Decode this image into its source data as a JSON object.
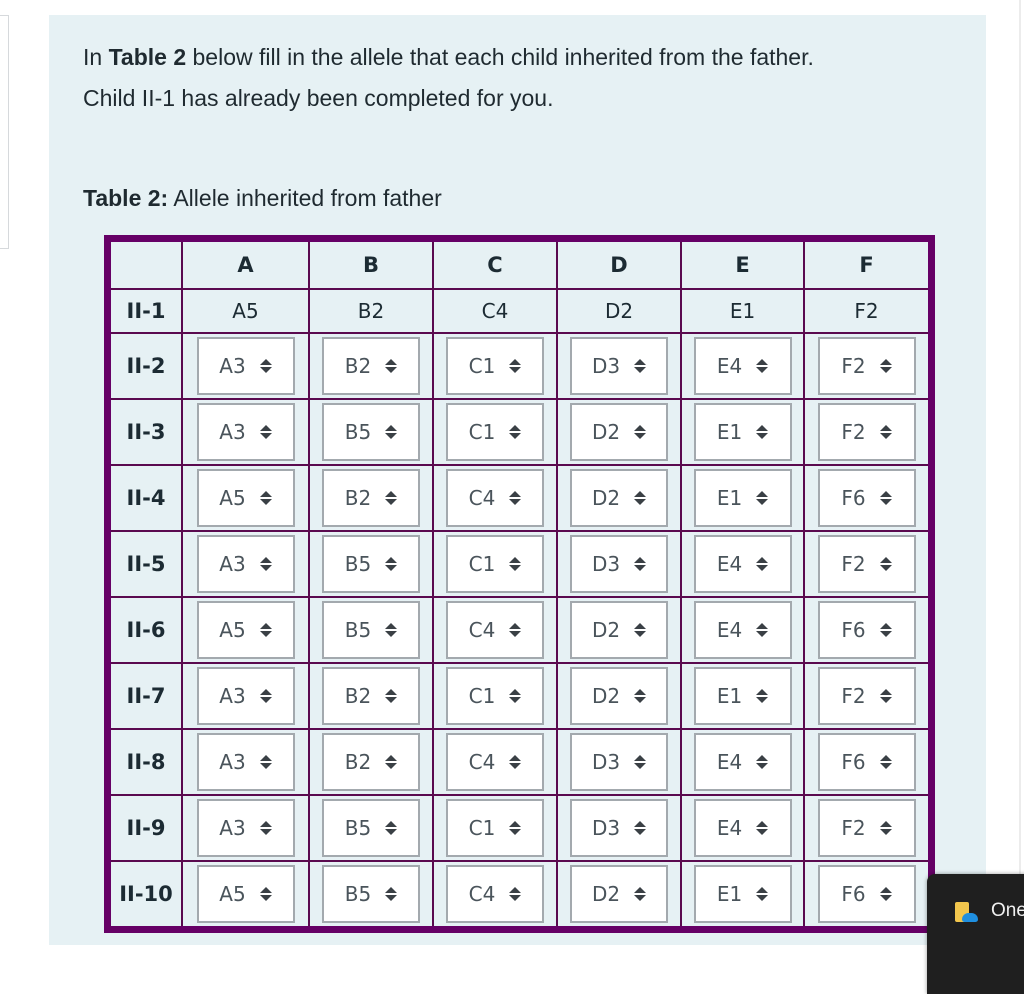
{
  "instructions": {
    "line1_pre": "In ",
    "line1_bold": "Table 2",
    "line1_post": " below fill in the allele that each child inherited from the father.",
    "line2": "Child II-1 has already been completed for you."
  },
  "caption": {
    "bold": "Table 2:",
    "text": " Allele inherited from father"
  },
  "table": {
    "columns": [
      "A",
      "B",
      "C",
      "D",
      "E",
      "F"
    ],
    "given_row": {
      "label": "II-1",
      "values": [
        "A5",
        "B2",
        "C4",
        "D2",
        "E1",
        "F2"
      ]
    },
    "rows": [
      {
        "label": "II-2",
        "values": [
          "A3",
          "B2",
          "C1",
          "D3",
          "E4",
          "F2"
        ]
      },
      {
        "label": "II-3",
        "values": [
          "A3",
          "B5",
          "C1",
          "D2",
          "E1",
          "F2"
        ]
      },
      {
        "label": "II-4",
        "values": [
          "A5",
          "B2",
          "C4",
          "D2",
          "E1",
          "F6"
        ]
      },
      {
        "label": "II-5",
        "values": [
          "A3",
          "B5",
          "C1",
          "D3",
          "E4",
          "F2"
        ]
      },
      {
        "label": "II-6",
        "values": [
          "A5",
          "B5",
          "C4",
          "D2",
          "E4",
          "F6"
        ]
      },
      {
        "label": "II-7",
        "values": [
          "A3",
          "B2",
          "C1",
          "D2",
          "E1",
          "F2"
        ]
      },
      {
        "label": "II-8",
        "values": [
          "A3",
          "B2",
          "C4",
          "D3",
          "E4",
          "F6"
        ]
      },
      {
        "label": "II-9",
        "values": [
          "A3",
          "B5",
          "C1",
          "D3",
          "E4",
          "F2"
        ]
      },
      {
        "label": "II-10",
        "values": [
          "A5",
          "B5",
          "C4",
          "D2",
          "E1",
          "F6"
        ]
      }
    ]
  },
  "toast": {
    "icon": "onedrive-folder-icon",
    "label": "OneDrive"
  },
  "colors": {
    "card_background": "#e6f1f4",
    "table_border": "#660066",
    "toast_background": "#1f1f1f"
  }
}
